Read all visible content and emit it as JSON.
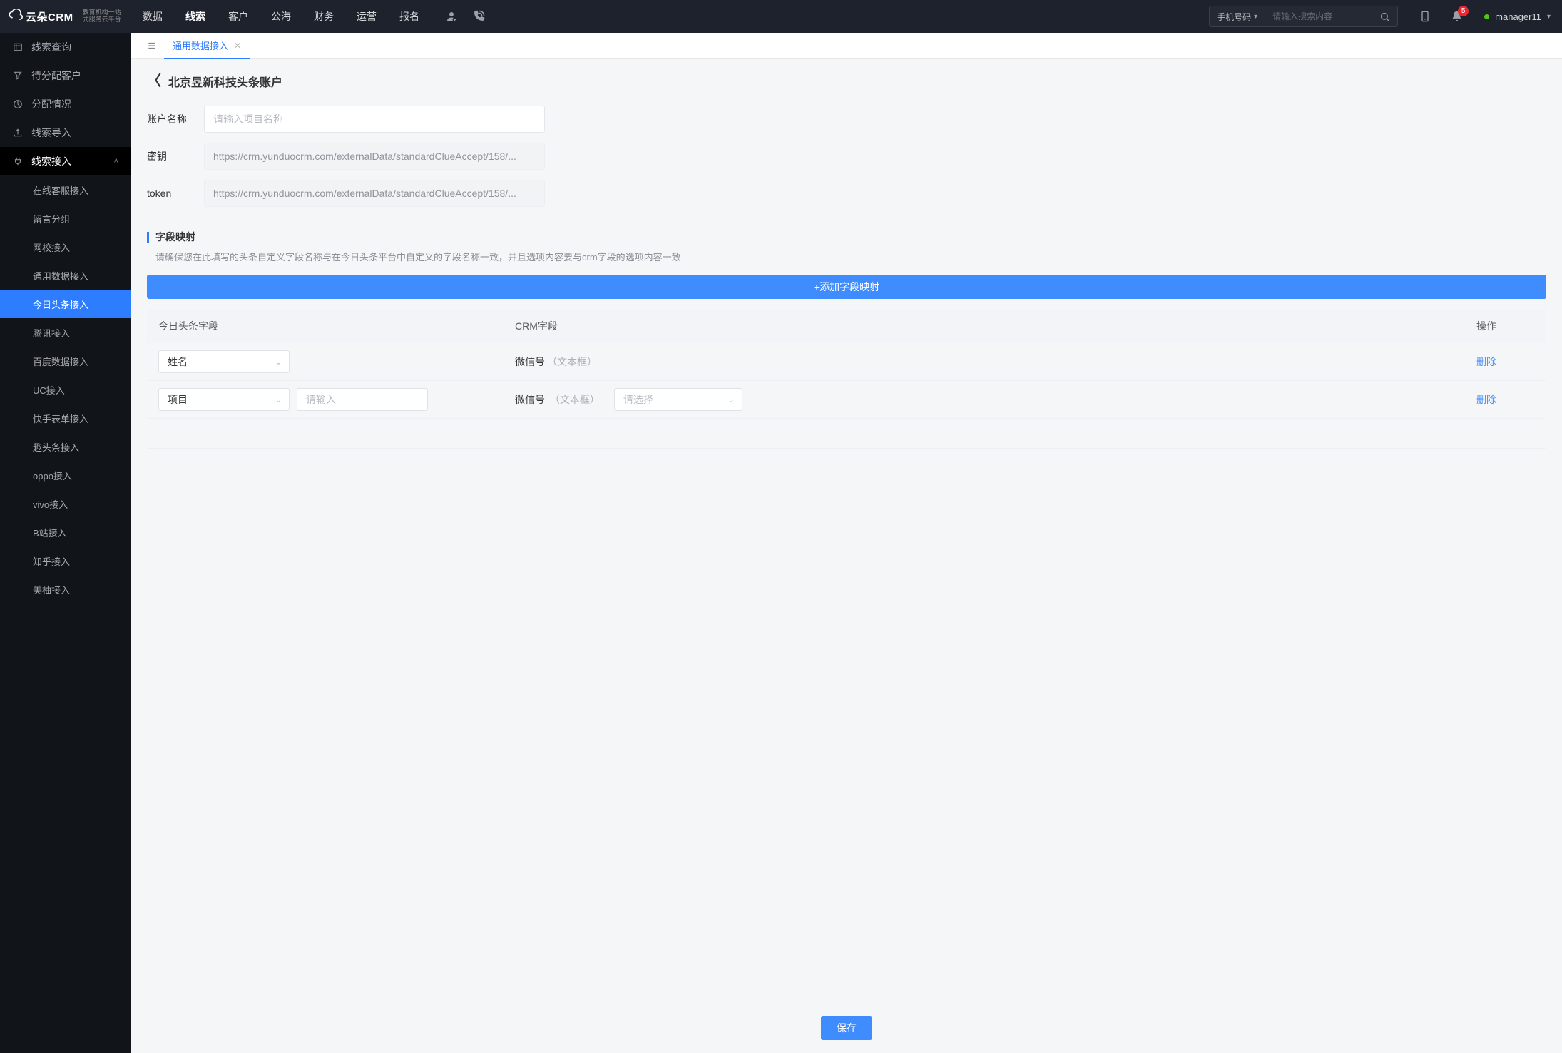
{
  "header": {
    "logo": "云朵CRM",
    "logo_sub1": "教育机构一站",
    "logo_sub2": "式服务云平台",
    "nav": [
      "数据",
      "线索",
      "客户",
      "公海",
      "财务",
      "运营",
      "报名"
    ],
    "nav_active": 1,
    "search_type": "手机号码",
    "search_placeholder": "请输入搜索内容",
    "badge": "5",
    "user": "manager11"
  },
  "sidebar": {
    "items": [
      {
        "label": "线索查询"
      },
      {
        "label": "待分配客户"
      },
      {
        "label": "分配情况"
      },
      {
        "label": "线索导入"
      },
      {
        "label": "线索接入",
        "expanded": true
      }
    ],
    "sub": [
      "在线客服接入",
      "留言分组",
      "网校接入",
      "通用数据接入",
      "今日头条接入",
      "腾讯接入",
      "百度数据接入",
      "UC接入",
      "快手表单接入",
      "趣头条接入",
      "oppo接入",
      "vivo接入",
      "B站接入",
      "知乎接入",
      "美柚接入"
    ],
    "sub_active": 4
  },
  "tab": {
    "label": "通用数据接入"
  },
  "page": {
    "title": "北京昱新科技头条账户",
    "form": {
      "name_label": "账户名称",
      "name_placeholder": "请输入项目名称",
      "secret_label": "密钥",
      "secret_value": "https://crm.yunduocrm.com/externalData/standardClueAccept/158/...",
      "token_label": "token",
      "token_value": "https://crm.yunduocrm.com/externalData/standardClueAccept/158/..."
    },
    "mapping": {
      "title": "字段映射",
      "desc": "请确保您在此填写的头条自定义字段名称与在今日头条平台中自定义的字段名称一致，并且选项内容要与crm字段的选项内容一致",
      "add_btn": "+添加字段映射",
      "cols": {
        "tt": "今日头条字段",
        "crm": "CRM字段",
        "op": "操作"
      },
      "rows": [
        {
          "tt_sel": "姓名",
          "tt_input": "",
          "tt_input_show": false,
          "crm_name": "微信号",
          "crm_hint": "（文本框）",
          "crm_sel": "",
          "crm_sel_show": false,
          "del": "删除"
        },
        {
          "tt_sel": "项目",
          "tt_input": "",
          "tt_input_show": true,
          "tt_input_ph": "请输入",
          "crm_name": "微信号",
          "crm_hint": "（文本框）",
          "crm_sel": "",
          "crm_sel_ph": "请选择",
          "crm_sel_show": true,
          "del": "删除"
        }
      ]
    },
    "save": "保存"
  }
}
